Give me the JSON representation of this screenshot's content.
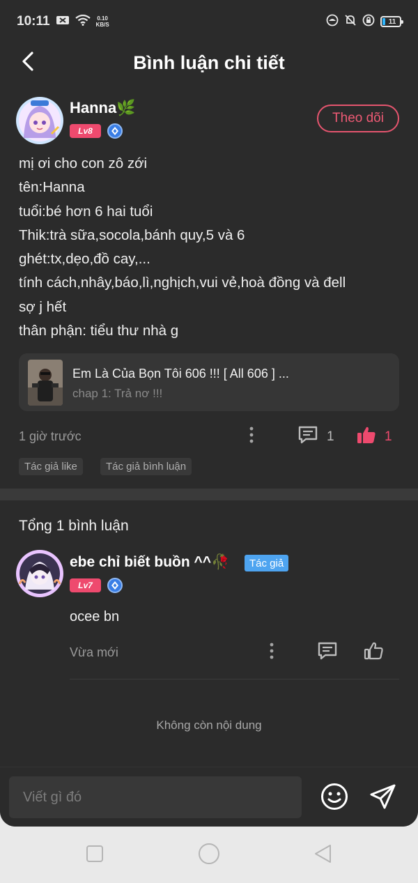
{
  "status_bar": {
    "time": "10:11",
    "net_speed_value": "0.10",
    "net_speed_unit": "KB/S",
    "battery": "11"
  },
  "header": {
    "title": "Bình luận chi tiết"
  },
  "post": {
    "author": "Hanna🌿",
    "level": "Lv8",
    "follow_label": "Theo dõi",
    "content_lines": [
      "mị ơi cho con zô zới",
      "tên:Hanna",
      "tuổi:bé hơn 6 hai tuổi",
      "Thik:trà sữa,socola,bánh quy,5 và 6",
      "ghét:tx,dẹo,đồ cay,...",
      "tính cách,nhây,báo,lì,nghịch,vui vẻ,hoà đồng và đell",
      "sợ j hết",
      "thân phận: tiểu thư nhà g"
    ],
    "reference": {
      "title": "Em Là Của Bọn Tôi 606 !!! [ All 606 ] ...",
      "subtitle": "chap 1: Trả nơ !!!"
    },
    "time": "1 giờ trước",
    "comment_count": "1",
    "like_count": "1",
    "tags": [
      "Tác giả like",
      "Tác giả bình luận"
    ]
  },
  "replies": {
    "total_label": "Tổng 1 bình luận",
    "items": [
      {
        "author": "ebe chỉ biết buồn ^^🥀",
        "author_tag": "Tác giả",
        "level": "Lv7",
        "text": "ocee bn",
        "time": "Vừa mới"
      }
    ],
    "end_note": "Không còn nội dung"
  },
  "input": {
    "placeholder": "Viết gì đó"
  },
  "colors": {
    "background": "#2b2b2b",
    "accent_pink": "#ee4a6e",
    "author_tag_blue": "#4ea4f0"
  },
  "icons": {
    "back": "chevron-left-icon",
    "more": "vertical-dots-icon",
    "comment": "comment-icon",
    "like": "thumbs-up-icon",
    "emoji": "smiley-icon",
    "send": "send-icon"
  }
}
